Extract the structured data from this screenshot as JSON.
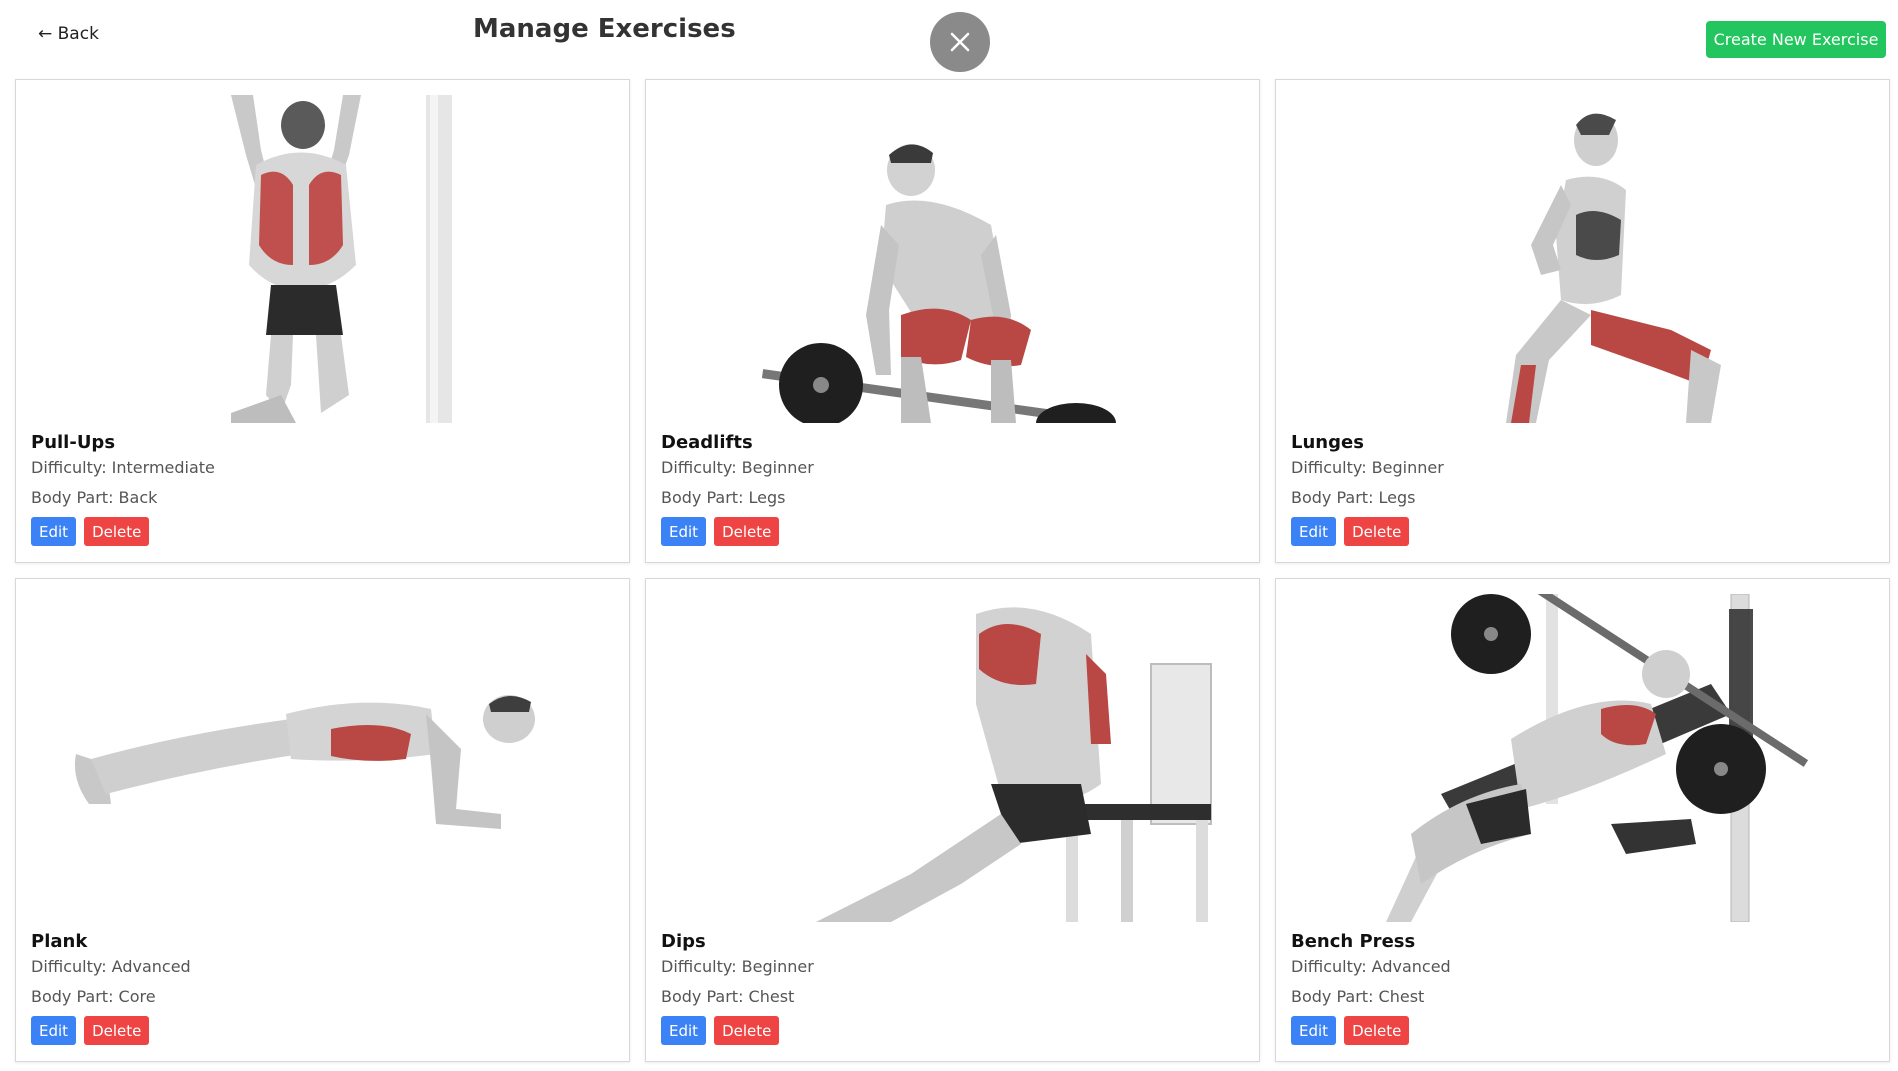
{
  "header": {
    "back_label": "← Back",
    "title": "Manage Exercises",
    "create_label": "Create New Exercise"
  },
  "colors": {
    "create": "#22c55e",
    "edit": "#3b82f6",
    "delete": "#ef4444",
    "close": "#8a8a8a"
  },
  "exercises": [
    {
      "name": "Pull-Ups",
      "difficulty": "Difficulty: Intermediate",
      "body_part": "Body Part: Back",
      "edit": "Edit",
      "delete": "Delete",
      "image": "pull-ups-illustration"
    },
    {
      "name": "Deadlifts",
      "difficulty": "Difficulty: Beginner",
      "body_part": "Body Part: Legs",
      "edit": "Edit",
      "delete": "Delete",
      "image": "deadlift-illustration"
    },
    {
      "name": "Lunges",
      "difficulty": "Difficulty: Beginner",
      "body_part": "Body Part: Legs",
      "edit": "Edit",
      "delete": "Delete",
      "image": "lunges-illustration"
    },
    {
      "name": "Plank",
      "difficulty": "Difficulty: Advanced",
      "body_part": "Body Part: Core",
      "edit": "Edit",
      "delete": "Delete",
      "image": "plank-illustration"
    },
    {
      "name": "Dips",
      "difficulty": "Difficulty: Beginner",
      "body_part": "Body Part: Chest",
      "edit": "Edit",
      "delete": "Delete",
      "image": "dips-illustration"
    },
    {
      "name": "Bench Press",
      "difficulty": "Difficulty: Advanced",
      "body_part": "Body Part: Chest",
      "edit": "Edit",
      "delete": "Delete",
      "image": "bench-press-illustration"
    }
  ]
}
